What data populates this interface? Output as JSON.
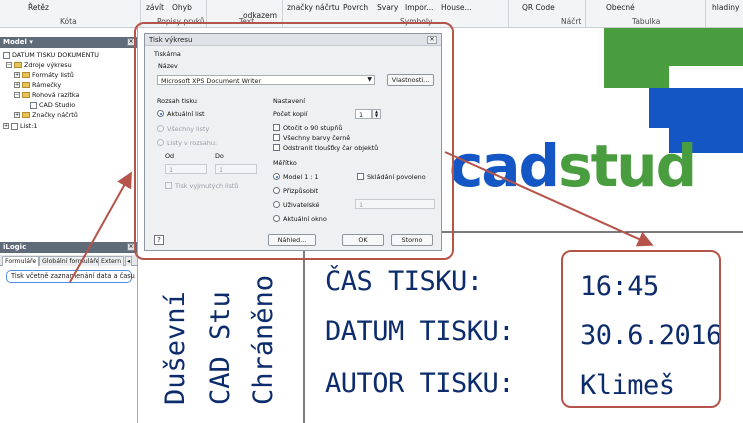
{
  "ribbon": {
    "items": [
      "závít",
      "Ohyb",
      "Řetěz",
      "Popisky prvků",
      "Text",
      "odkazem",
      "značky náčrtu",
      "Povrch",
      "Svary",
      "Impor...",
      "House...",
      "QR Code",
      "Obecné",
      "hladiny"
    ],
    "groups": [
      "Kóta",
      "Popisy prvků",
      "Text",
      "Symboly",
      "Náčrt",
      "Tabulka"
    ]
  },
  "model_browser": {
    "title": "Model ▾",
    "items": [
      "DATUM TISKU DOKUMENTU",
      "Zdroje výkresu",
      "Formáty listů",
      "Rámečky",
      "Rohová razítka",
      "CAD Studio",
      "Značky náčrtů",
      "List:1"
    ]
  },
  "ilogic": {
    "title": "iLogic",
    "tabs": [
      "Formuláře",
      "Globální formuláře",
      "Extern"
    ],
    "rule_button": "Tisk včetně zaznamenání data a času"
  },
  "dialog": {
    "title": "Tisk výkresu",
    "printer_section": "Tiskárna",
    "name_label": "Název",
    "printer_value": "Microsoft XPS Document Writer",
    "properties_button": "Vlastnosti...",
    "range_section": "Rozsah tisku",
    "range_current": "Aktuální list",
    "range_all": "Všechny listy",
    "range_sheets": "Listy v rozsahu:",
    "from_label": "Od",
    "to_label": "Do",
    "from_value": "1",
    "to_value": "1",
    "print_excluded": "Tisk vyjmutých listů",
    "settings_section": "Nastavení",
    "copies_label": "Počet kopií",
    "copies_value": "1",
    "rotate": "Otočit o 90 stupňů",
    "all_black": "Všechny barvy černě",
    "remove_thickness": "Odstranit tloušťky čar objektů",
    "scale_section": "Měřítko",
    "scale_model": "Model 1 : 1",
    "scale_fit": "Přizpůsobit",
    "scale_custom": "Uživatelské",
    "scale_custom_value": "1",
    "scale_window": "Aktuální okno",
    "collate": "Skládání povoleno",
    "preview_button": "Náhled...",
    "ok_button": "OK",
    "cancel_button": "Storno"
  },
  "drawing": {
    "logo_text": "cadstud",
    "vertical_texts": [
      "Duševní",
      "CAD Stu",
      "Chráněno"
    ],
    "labels": [
      "ČAS TISKU:",
      "DATUM TISKU:",
      "AUTOR TISKU:"
    ],
    "values": [
      "16:45",
      "30.6.2016",
      "Klimeš"
    ]
  },
  "colors": {
    "logo_blue": "#1556c5",
    "logo_green": "#4a9d3f",
    "stamp_text": "#0d2c6b",
    "highlight": "#b5544a"
  }
}
